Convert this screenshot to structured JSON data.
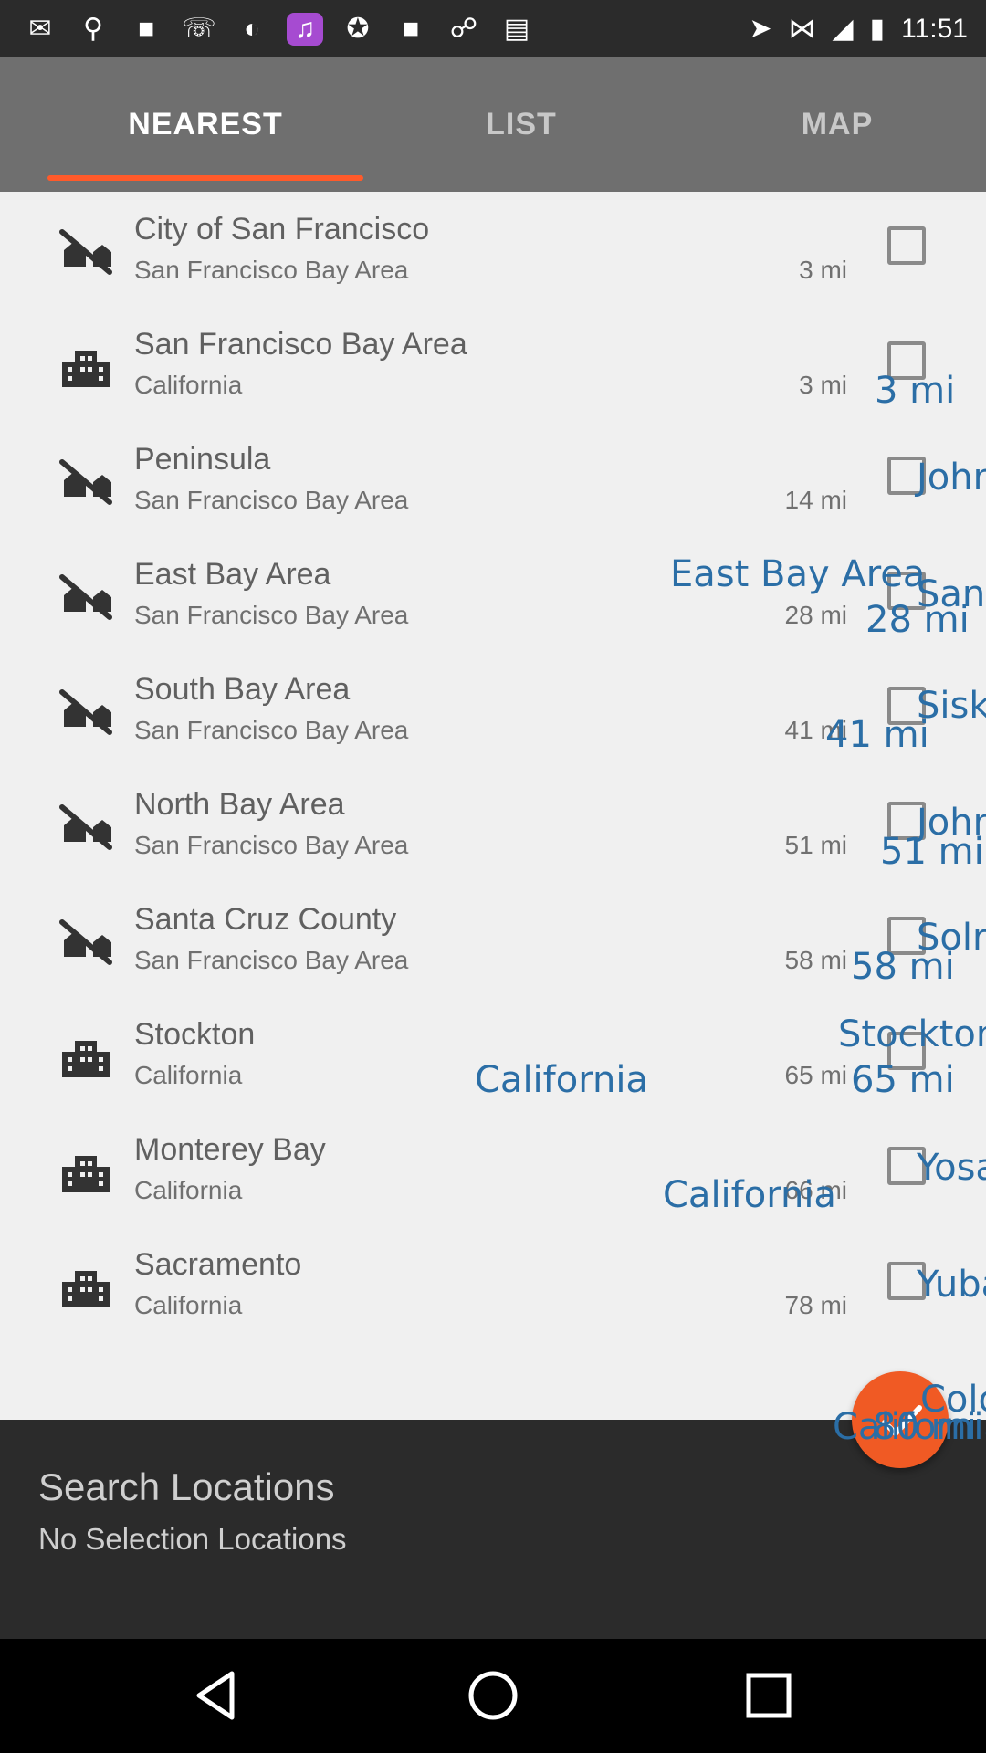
{
  "status_bar": {
    "time": "11:51",
    "left_icons": [
      "message-icon",
      "usb-icon",
      "flipboard-icon",
      "phone-icon",
      "theme-icon",
      "music-icon",
      "sport-icon",
      "flipboard-icon",
      "link-icon",
      "cassette-icon"
    ],
    "right_icons": [
      "location-icon",
      "bluetooth-icon",
      "signal-icon",
      "battery-icon"
    ]
  },
  "tabs": [
    {
      "label": "NEAREST",
      "active": true
    },
    {
      "label": "LIST",
      "active": false
    },
    {
      "label": "MAP",
      "active": false
    }
  ],
  "colors": {
    "tab_bar": "#6f6f6f",
    "indicator": "#ff5a2a",
    "overlay_text": "#2b6ea6",
    "fab": "#f05a24",
    "panel": "#2b2b2b"
  },
  "locations": [
    {
      "title": "City of San Francisco",
      "subtitle": "San Francisco Bay Area",
      "distance": "3 mi",
      "icon": "region-icon"
    },
    {
      "title": "San Francisco Bay Area",
      "subtitle": "California",
      "distance": "3 mi",
      "icon": "city-icon"
    },
    {
      "title": "Peninsula",
      "subtitle": "San Francisco Bay Area",
      "distance": "14 mi",
      "icon": "region-icon"
    },
    {
      "title": "East Bay Area",
      "subtitle": "San Francisco Bay Area",
      "distance": "28 mi",
      "icon": "region-icon"
    },
    {
      "title": "South Bay Area",
      "subtitle": "San Francisco Bay Area",
      "distance": "41 mi",
      "icon": "region-icon"
    },
    {
      "title": "North Bay Area",
      "subtitle": "San Francisco Bay Area",
      "distance": "51 mi",
      "icon": "region-icon"
    },
    {
      "title": "Santa Cruz County",
      "subtitle": "San Francisco Bay Area",
      "distance": "58 mi",
      "icon": "region-icon"
    },
    {
      "title": "Stockton",
      "subtitle": "California",
      "distance": "65 mi",
      "icon": "city-icon"
    },
    {
      "title": "Monterey Bay",
      "subtitle": "California",
      "distance": "66 mi",
      "icon": "city-icon"
    },
    {
      "title": "Sacramento",
      "subtitle": "California",
      "distance": "78 mi",
      "icon": "city-icon"
    }
  ],
  "overlays": {
    "t1": "3 mi",
    "t2": "John",
    "t3": "East Bay Area",
    "t4": "Sant",
    "t5": "28 mi",
    "t6": "Sisk",
    "t7": "41 mi",
    "t8": "John",
    "t9": "51 mi",
    "t10": "Solr",
    "t11": "58 mi",
    "t12": "Stockton",
    "t13": "California",
    "t14": "65 mi",
    "t15": "Yosa",
    "t16": "California",
    "t17": "Yuba",
    "t18": "Colo",
    "t19": "California",
    "t20": "80 mi"
  },
  "panel": {
    "title": "Search Locations",
    "subtitle": "No Selection Locations"
  },
  "fab": {
    "icon": "check-icon"
  },
  "nav": {
    "back": "back-icon",
    "home": "home-icon",
    "recents": "recents-icon"
  }
}
